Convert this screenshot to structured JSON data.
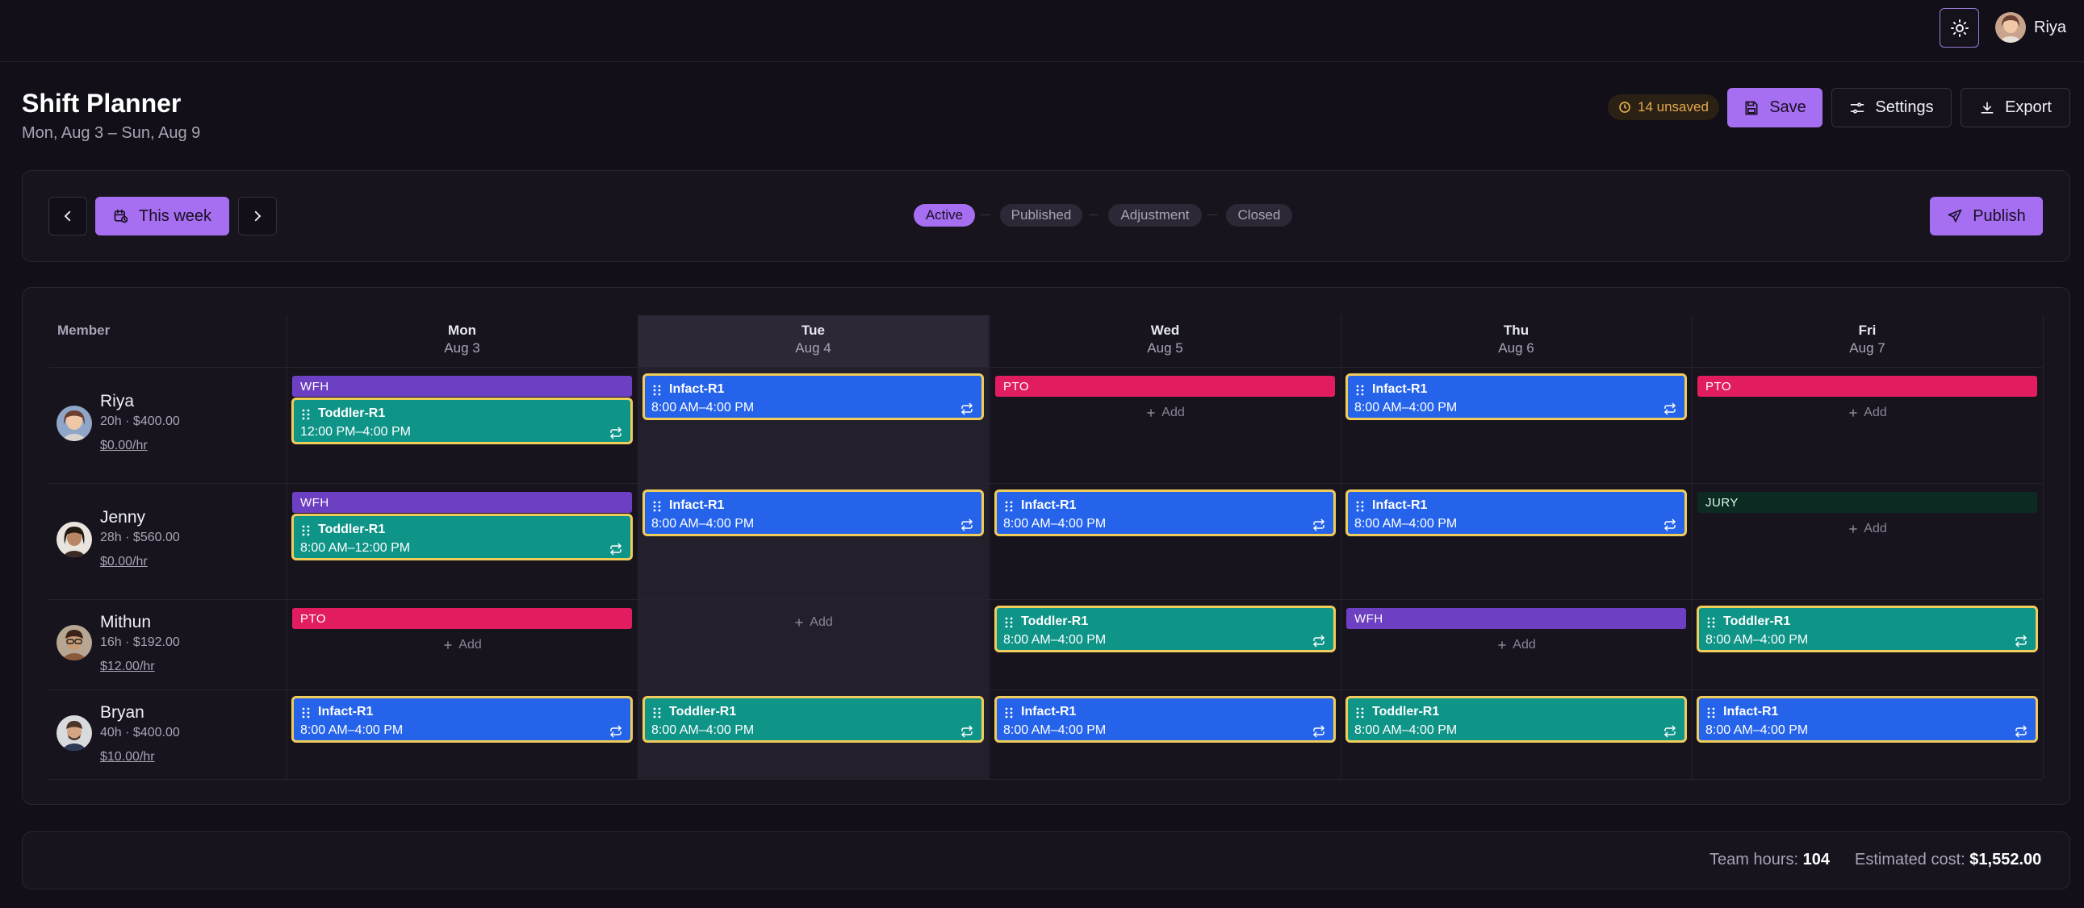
{
  "header": {
    "user_name": "Riya",
    "title": "Shift Planner",
    "date_range": "Mon, Aug 3 – Sun, Aug 9",
    "unsaved_badge": "14 unsaved",
    "save_label": "Save",
    "settings_label": "Settings",
    "export_label": "Export"
  },
  "toolbar": {
    "this_week_label": "This week",
    "publish_label": "Publish",
    "statuses": [
      "Active",
      "Published",
      "Adjustment",
      "Closed"
    ],
    "active_status": "Active"
  },
  "grid": {
    "member_header": "Member",
    "days": [
      {
        "name": "Mon",
        "date": "Aug 3",
        "highlighted": false
      },
      {
        "name": "Tue",
        "date": "Aug 4",
        "highlighted": true
      },
      {
        "name": "Wed",
        "date": "Aug 5",
        "highlighted": false
      },
      {
        "name": "Thu",
        "date": "Aug 6",
        "highlighted": false
      },
      {
        "name": "Fri",
        "date": "Aug 7",
        "highlighted": false
      }
    ],
    "add_label": "Add",
    "members": [
      {
        "name": "Riya",
        "stats": "20h · $400.00",
        "rate": "$0.00/hr"
      },
      {
        "name": "Jenny",
        "stats": "28h · $560.00",
        "rate": "$0.00/hr"
      },
      {
        "name": "Mithun",
        "stats": "16h · $192.00",
        "rate": "$12.00/hr"
      },
      {
        "name": "Bryan",
        "stats": "40h · $400.00",
        "rate": "$10.00/hr"
      }
    ],
    "cells": [
      {
        "tags": [
          "WFH",
          "Toddler-R1"
        ],
        "tag": "WFH",
        "shift": {
          "title": "Toddler-R1",
          "time": "12:00 PM–4:00 PM"
        }
      },
      {
        "shift": {
          "title": "Infact-R1",
          "time": "8:00 AM–4:00 PM"
        }
      },
      {
        "tag": "PTO"
      },
      {
        "shift": {
          "title": "Infact-R1",
          "time": "8:00 AM–4:00 PM"
        }
      },
      {
        "tag": "PTO"
      },
      {
        "tag": "WFH",
        "shift": {
          "title": "Toddler-R1",
          "time": "8:00 AM–12:00 PM"
        }
      },
      {
        "shift": {
          "title": "Infact-R1",
          "time": "8:00 AM–4:00 PM"
        }
      },
      {
        "shift": {
          "title": "Infact-R1",
          "time": "8:00 AM–4:00 PM"
        }
      },
      {
        "shift": {
          "title": "Infact-R1",
          "time": "8:00 AM–4:00 PM"
        }
      },
      {
        "tag": "JURY"
      },
      {
        "tag": "PTO"
      },
      {},
      {
        "shift": {
          "title": "Toddler-R1",
          "time": "8:00 AM–4:00 PM"
        }
      },
      {
        "tag": "WFH"
      },
      {
        "shift": {
          "title": "Toddler-R1",
          "time": "8:00 AM–4:00 PM"
        }
      },
      {
        "shift": {
          "title": "Infact-R1",
          "time": "8:00 AM–4:00 PM"
        }
      },
      {
        "shift": {
          "title": "Toddler-R1",
          "time": "8:00 AM–4:00 PM"
        }
      },
      {
        "shift": {
          "title": "Infact-R1",
          "time": "8:00 AM–4:00 PM"
        }
      },
      {
        "shift": {
          "title": "Toddler-R1",
          "time": "8:00 AM–4:00 PM"
        }
      },
      {
        "shift": {
          "title": "Infact-R1",
          "time": "8:00 AM–4:00 PM"
        }
      }
    ]
  },
  "footer": {
    "team_hours_label": "Team hours:",
    "team_hours_value": "104",
    "estimated_cost_label": "Estimated cost:",
    "estimated_cost_value": "$1,552.00"
  },
  "colors": {
    "accent": "#a66ef0",
    "infact_shift": "#2563eb",
    "toddler_shift": "#0f9488",
    "wfh_tag": "#6d3fc2",
    "pto_tag": "#e11d5f",
    "jury_tag": "#0c2a22",
    "shift_border": "#f0cc5a"
  }
}
